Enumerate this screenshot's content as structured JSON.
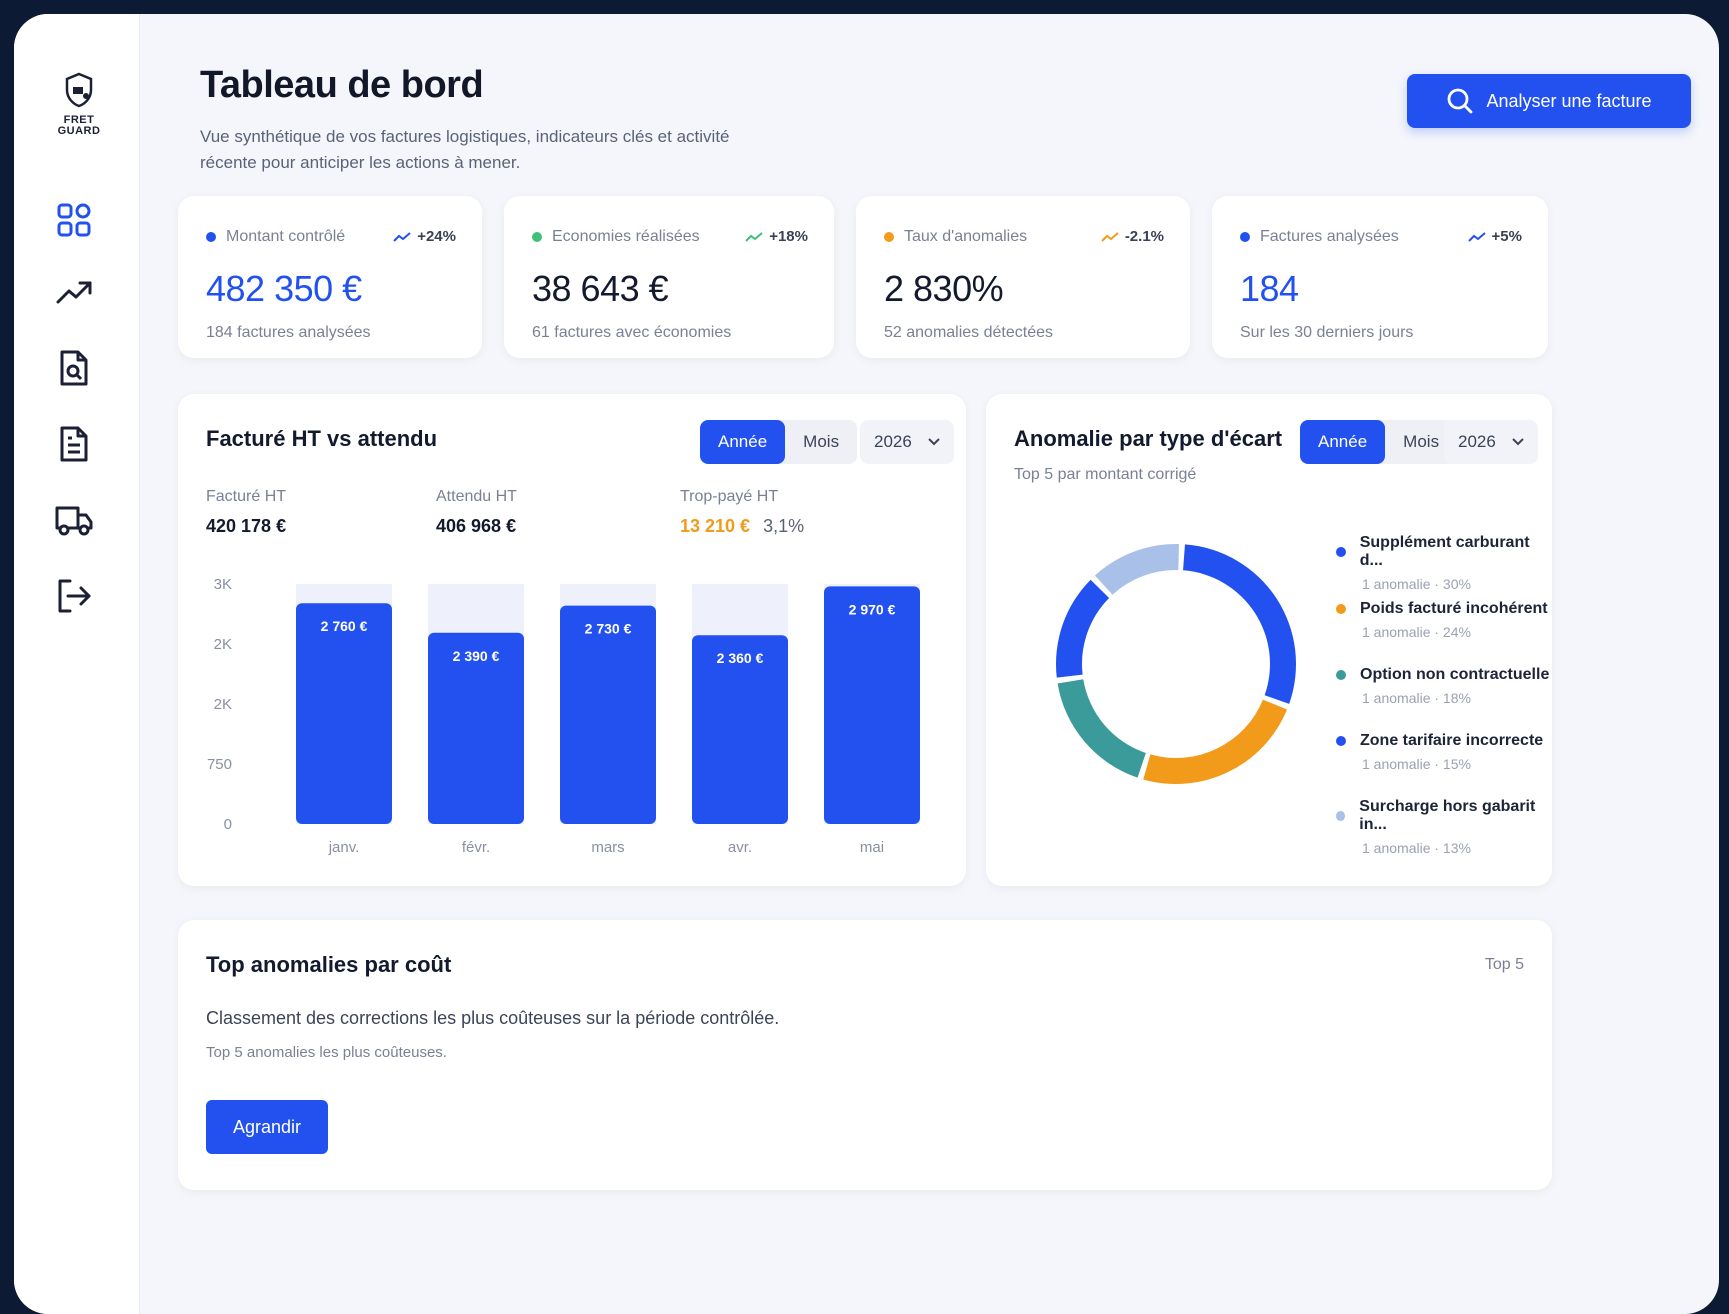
{
  "app": {
    "logo_line1": "FRET",
    "logo_line2": "GUARD"
  },
  "sidebar": {
    "items": [
      {
        "name": "dashboard"
      },
      {
        "name": "trends"
      },
      {
        "name": "invoice-search"
      },
      {
        "name": "documents"
      },
      {
        "name": "transport"
      },
      {
        "name": "logout"
      }
    ]
  },
  "header": {
    "title": "Tableau de bord",
    "subtitle": "Vue synthétique de vos factures logistiques, indicateurs clés et activité récente pour anticiper les actions à mener.",
    "analyze_label": "Analyser une facture"
  },
  "kpis": [
    {
      "label": "Montant contrôlé",
      "trend": "+24%",
      "value": "482 350 €",
      "sub": "184 factures analysées",
      "dot_color": "#2251f0",
      "value_color": "#2251f0",
      "trend_color": "#2251f0"
    },
    {
      "label": "Economies réalisées",
      "trend": "+18%",
      "value": "38 643 €",
      "sub": "61 factures avec économies",
      "dot_color": "#3ec07a",
      "value_color": "#141a2e",
      "trend_color": "#3ec07a"
    },
    {
      "label": "Taux d'anomalies",
      "trend": "-2.1%",
      "value": "2 830%",
      "sub": "52 anomalies détectées",
      "dot_color": "#f29a1a",
      "value_color": "#141a2e",
      "trend_color": "#f29a1a"
    },
    {
      "label": "Factures analysées",
      "trend": "+5%",
      "value": "184",
      "sub": "Sur les 30 derniers jours",
      "dot_color": "#2251f0",
      "value_color": "#2251f0",
      "trend_color": "#2251f0"
    }
  ],
  "bar_card": {
    "title": "Facturé HT vs attendu",
    "seg_year": "Année",
    "seg_month": "Mois",
    "year": "2026",
    "stats": {
      "billed_label": "Facturé HT",
      "billed_value": "420 178 €",
      "expected_label": "Attendu HT",
      "expected_value": "406 968 €",
      "overpaid_label": "Trop-payé HT",
      "overpaid_value": "13 210 €",
      "overpaid_pct": "3,1%"
    }
  },
  "donut_card": {
    "title": "Anomalie par type d'écart",
    "subtitle": "Top 5 par montant corrigé",
    "seg_year": "Année",
    "seg_month": "Mois",
    "year": "2026",
    "legend": [
      {
        "name": "Supplément carburant d...",
        "meta": "1 anomalie · 30%",
        "color": "#2251f0"
      },
      {
        "name": "Poids facturé incohérent",
        "meta": "1 anomalie · 24%",
        "color": "#f29a1a"
      },
      {
        "name": "Option non contractuelle",
        "meta": "1 anomalie · 18%",
        "color": "#3b9a9a"
      },
      {
        "name": "Zone tarifaire incorrecte",
        "meta": "1 anomalie · 15%",
        "color": "#2251f0"
      },
      {
        "name": "Surcharge hors gabarit in...",
        "meta": "1 anomalie · 13%",
        "color": "#a9c1e8"
      }
    ]
  },
  "top_card": {
    "title": "Top anomalies par coût",
    "badge": "Top 5",
    "description": "Classement des corrections les plus coûteuses sur la période contrôlée.",
    "note": "Top 5 anomalies les plus coûteuses.",
    "expand_label": "Agrandir"
  },
  "chart_data": [
    {
      "type": "bar",
      "categories": [
        "janv.",
        "févr.",
        "mars",
        "avr.",
        "mai"
      ],
      "values": [
        2760,
        2390,
        2730,
        2360,
        2970
      ],
      "value_labels": [
        "2 760 €",
        "2 390 €",
        "2 730 €",
        "2 360 €",
        "2 970 €"
      ],
      "ytick_labels": [
        "0",
        "750",
        "2K",
        "2K",
        "3K"
      ],
      "ylim": [
        0,
        3000
      ],
      "bar_color": "#2251f0",
      "track_color": "#eef0fb"
    },
    {
      "type": "pie",
      "donut": true,
      "categories": [
        "Supplément carburant d...",
        "Poids facturé incohérent",
        "Option non contractuelle",
        "Zone tarifaire incorrecte",
        "Surcharge hors gabarit in..."
      ],
      "values": [
        30,
        24,
        18,
        15,
        13
      ],
      "colors": [
        "#2251f0",
        "#f29a1a",
        "#3b9a9a",
        "#2251f0",
        "#a9c1e8"
      ]
    }
  ]
}
